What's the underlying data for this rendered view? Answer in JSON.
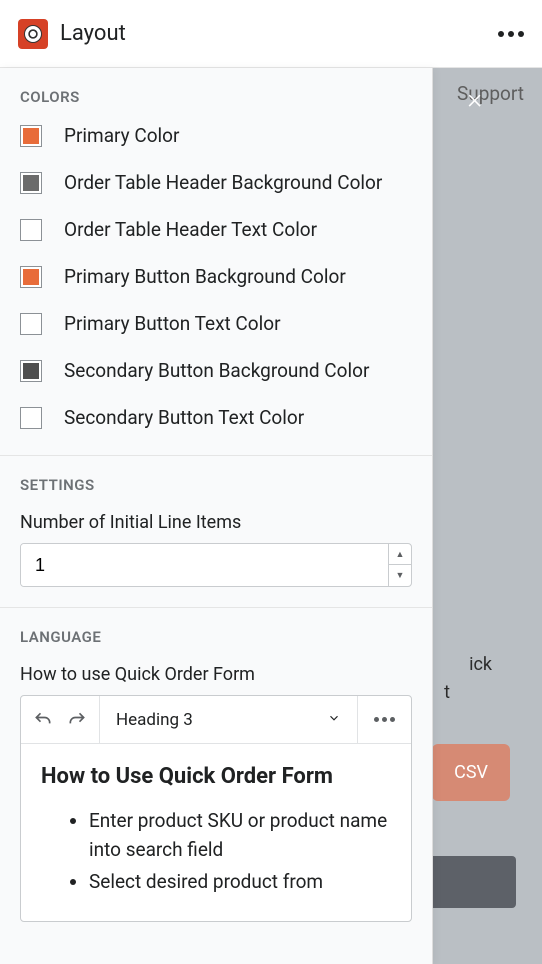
{
  "header": {
    "title": "Layout"
  },
  "backdrop": {
    "support": "Support",
    "text1": "ick",
    "text2": "t",
    "csv": "CSV"
  },
  "sections": {
    "colors": {
      "heading": "COLORS",
      "items": [
        {
          "label": "Primary Color",
          "swatch": "#e86c3a"
        },
        {
          "label": "Order Table Header Background Color",
          "swatch": "#6b6b6b"
        },
        {
          "label": "Order Table Header Text Color",
          "swatch": "#ffffff"
        },
        {
          "label": "Primary Button Background Color",
          "swatch": "#e86c3a"
        },
        {
          "label": "Primary Button Text Color",
          "swatch": "#ffffff"
        },
        {
          "label": "Secondary Button Background Color",
          "swatch": "#4f4f4f"
        },
        {
          "label": "Secondary Button Text Color",
          "swatch": "#ffffff"
        }
      ]
    },
    "settings": {
      "heading": "SETTINGS",
      "line_items_label": "Number of Initial Line Items",
      "line_items_value": "1"
    },
    "language": {
      "heading": "LANGUAGE",
      "field_label": "How to use Quick Order Form",
      "format": "Heading 3",
      "content_heading": "How to Use Quick Order Form",
      "bullets": [
        "Enter product SKU or product name into search field",
        "Select desired product from"
      ]
    }
  }
}
